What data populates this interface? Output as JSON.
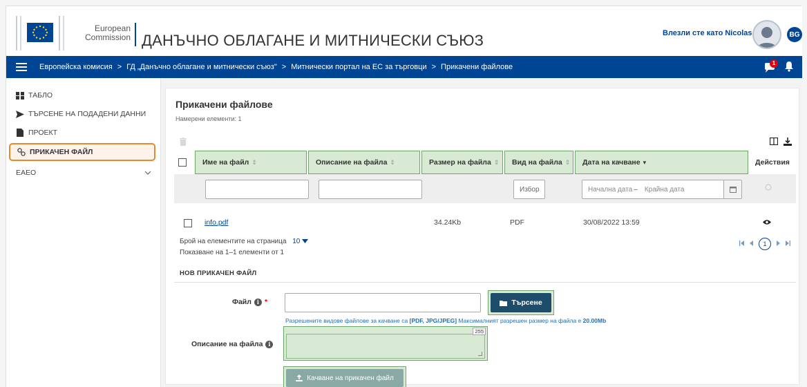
{
  "header": {
    "logo_line1": "European",
    "logo_line2": "Commission",
    "site_title": "ДАНЪЧНО ОБЛАГАНЕ И МИТНИЧЕСКИ СЪЮЗ",
    "logged_in": "Влезли сте като Nicolas",
    "language": "BG"
  },
  "nav": {
    "breadcrumbs": [
      "Европейска комисия",
      "ГД „Данъчно облагане и митнически съюз\"",
      "Митнически портал на ЕС за търговци",
      "Прикачени файлове"
    ],
    "separator": ">",
    "notification_count": "1"
  },
  "sidebar": {
    "items": [
      {
        "label": "ТАБЛО",
        "icon": "dashboard-icon"
      },
      {
        "label": "ТЪРСЕНЕ НА ПОДАДЕНИ ДАННИ",
        "icon": "send-icon"
      },
      {
        "label": "ПРОЕКТ",
        "icon": "document-icon"
      },
      {
        "label": "ПРИКАЧЕН ФАЙЛ",
        "icon": "attachment-icon",
        "active": true
      },
      {
        "label": "EAEO",
        "icon": "chevron-down-icon"
      }
    ]
  },
  "main": {
    "title": "Прикачени файлове",
    "subtitle": "Намерени елементи: 1",
    "columns": [
      "Име на файл",
      "Описание на файла",
      "Размер на файла",
      "Вид на файла",
      "Дата на качване",
      "Действия"
    ],
    "filters": {
      "type_placeholder": "Избор",
      "date_start": "Начална дата",
      "date_sep": "–",
      "date_end": "Крайна дата"
    },
    "rows": [
      {
        "name": "info.pdf",
        "description": "",
        "size": "34.24Kb",
        "type": "PDF",
        "date": "30/08/2022 13:59"
      }
    ],
    "per_page_label": "Брой на елементите на страница",
    "per_page_value": "10",
    "showing": "Показване на 1–1 елементи от 1",
    "current_page": "1"
  },
  "form": {
    "section_title": "НОВ ПРИКАЧЕН ФАЙЛ",
    "file_label": "Файл",
    "required_mark": "*",
    "search_button": "Търсене",
    "hint_prefix": "Разрешените видове файлове за качване са ",
    "hint_types": "[PDF, JPG/JPEG]",
    "hint_mid": " Максималният разрешен размер на файла е ",
    "hint_size": "20.00Mb",
    "desc_label": "Описание на файла",
    "char_counter": "255",
    "upload_button": "Качване на прикачен файл"
  },
  "colors": {
    "brand_blue": "#004494",
    "highlight_green": "#d8ead4",
    "active_orange": "#e38b2a"
  }
}
